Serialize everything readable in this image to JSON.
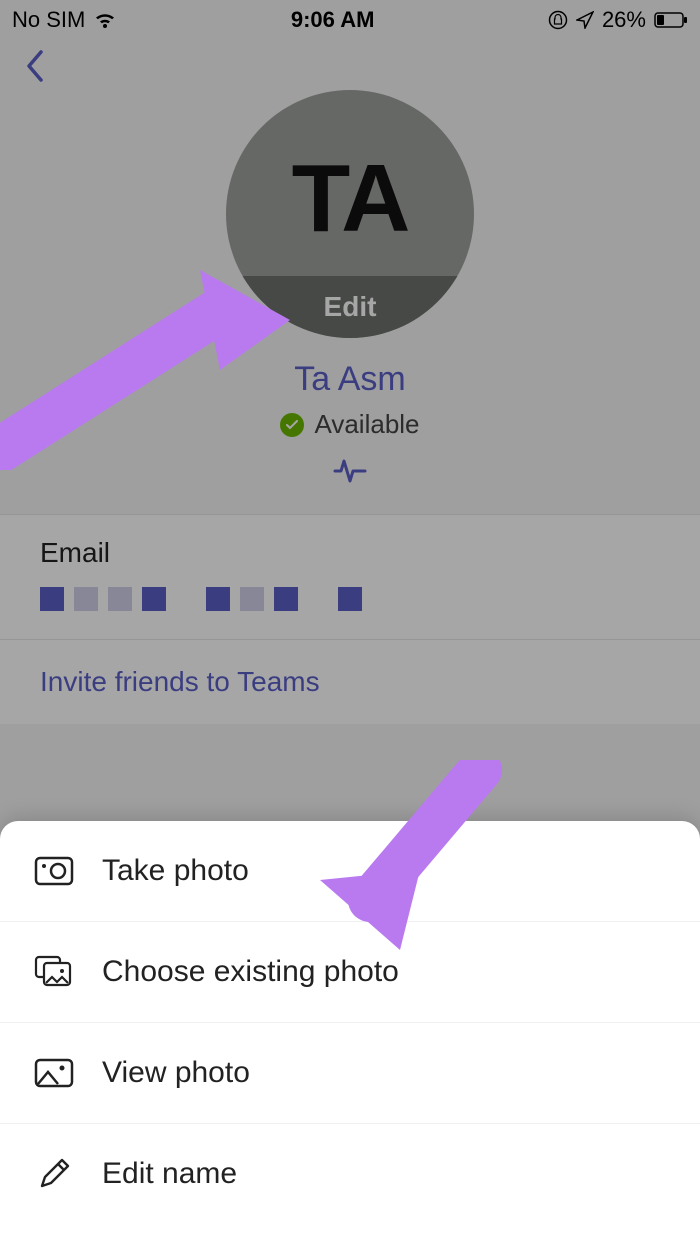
{
  "status_bar": {
    "sim": "No SIM",
    "time": "9:06 AM",
    "battery": "26%"
  },
  "profile": {
    "initials": "TA",
    "edit_label": "Edit",
    "name": "Ta Asm",
    "presence": "Available"
  },
  "sections": {
    "email_label": "Email",
    "invite_label": "Invite friends to Teams"
  },
  "sheet": {
    "take_photo": "Take photo",
    "choose_photo": "Choose existing photo",
    "view_photo": "View photo",
    "edit_name": "Edit name"
  }
}
